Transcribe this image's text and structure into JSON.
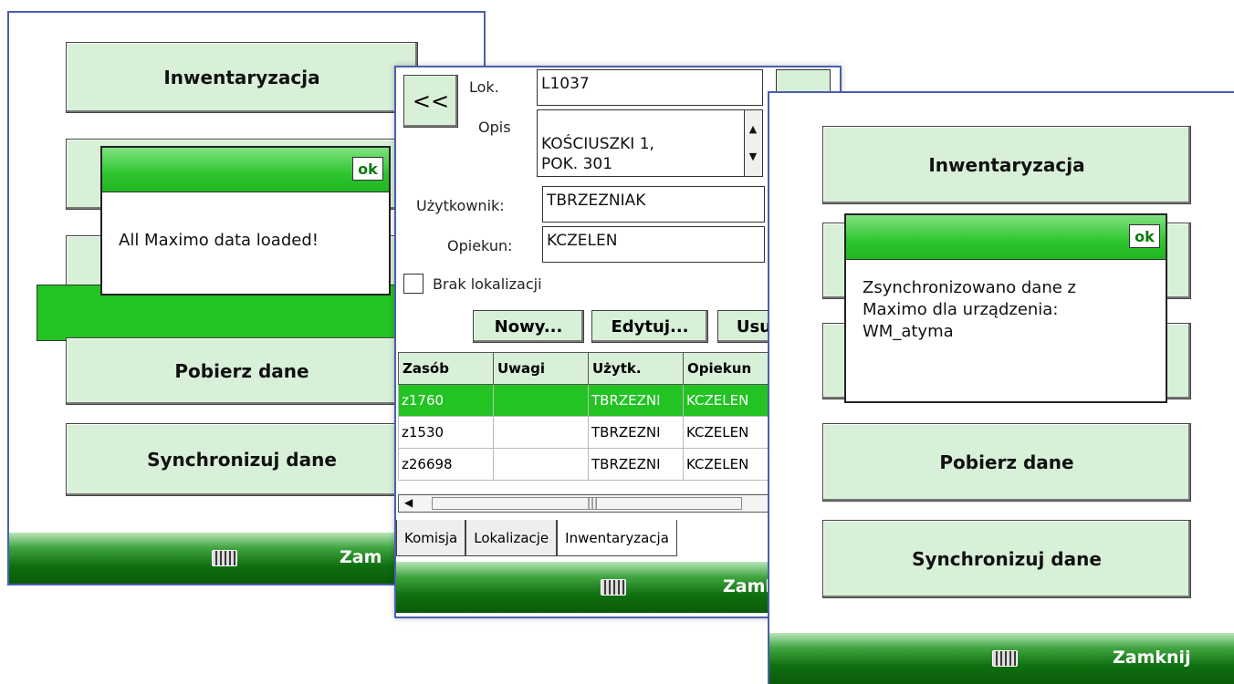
{
  "screen_left": {
    "buttons": {
      "inventory": "Inwentaryzacja",
      "download": "Pobierz dane",
      "sync": "Synchronizuj dane"
    },
    "dialog": {
      "ok": "ok",
      "message": "All Maximo data loaded!"
    },
    "taskbar": {
      "close": "Zam"
    }
  },
  "screen_middle": {
    "back": "<<",
    "labels": {
      "lok": "Lok.",
      "opis": "Opis",
      "user": "Użytkownik:",
      "keeper": "Opiekun:",
      "no_location": "Brak lokalizacji"
    },
    "values": {
      "lok": "L1037",
      "opis": "KOŚCIUSZKI 1,\nPOK. 301",
      "user": "TBRZEZNIAK",
      "keeper": "KCZELEN"
    },
    "buttons": {
      "new": "Nowy...",
      "edit": "Edytuj...",
      "delete": "Usu"
    },
    "table": {
      "headers": [
        "Zasób",
        "Uwagi",
        "Użytk.",
        "Opiekun"
      ],
      "rows": [
        [
          "z1760",
          "",
          "TBRZEZNI",
          "KCZELEN"
        ],
        [
          "z1530",
          "",
          "TBRZEZNI",
          "KCZELEN"
        ],
        [
          "z26698",
          "",
          "TBRZEZNI",
          "KCZELEN"
        ]
      ],
      "selected_row": 0
    },
    "tabs": [
      "Komisja",
      "Lokalizacje",
      "Inwentaryzacja"
    ],
    "active_tab": "Inwentaryzacja",
    "taskbar": {
      "close": "Zamk"
    }
  },
  "screen_right": {
    "buttons": {
      "inventory": "Inwentaryzacja",
      "download": "Pobierz dane",
      "sync": "Synchronizuj dane"
    },
    "dialog": {
      "ok": "ok",
      "message": "Zsynchronizowano dane z\nMaximo dla urządzenia:\nWM_atyma"
    },
    "taskbar": {
      "close": "Zamknij"
    }
  },
  "colors": {
    "accent_green": "#22c322",
    "button_bg": "#d8efd8",
    "frame_blue": "#4a5fb0"
  },
  "icons": {
    "keyboard": "keyboard-icon",
    "scroll_up": "arrow-up-icon",
    "scroll_down": "arrow-down-icon"
  }
}
